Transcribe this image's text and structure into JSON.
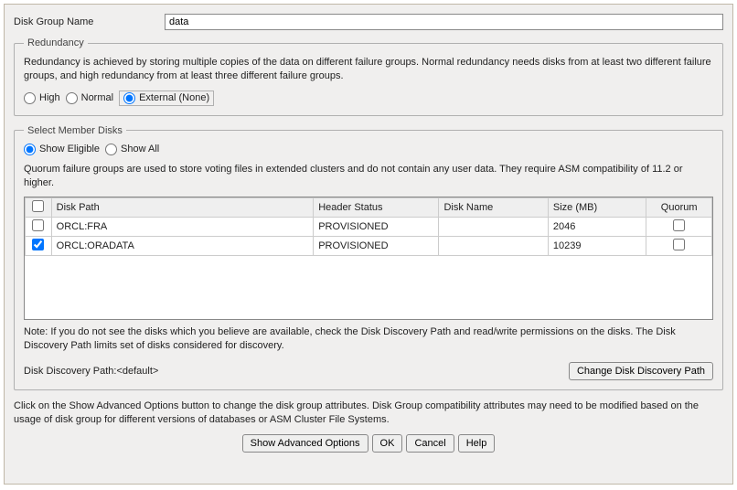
{
  "group_name_label": "Disk Group Name",
  "group_name_value": "data",
  "redundancy": {
    "legend": "Redundancy",
    "desc": "Redundancy is achieved by storing multiple copies of the data on different failure groups. Normal redundancy needs disks from at least two different failure groups, and high redundancy from at least three different failure groups.",
    "high": "High",
    "normal": "Normal",
    "external": "External (None)"
  },
  "member_disks": {
    "legend": "Select Member Disks",
    "show_eligible": "Show Eligible",
    "show_all": "Show All",
    "quorum_desc": "Quorum failure groups are used to store voting files in extended clusters and do not contain any user data. They require ASM compatibility of 11.2 or higher.",
    "columns": {
      "disk_path": "Disk Path",
      "header_status": "Header Status",
      "disk_name": "Disk Name",
      "size_mb": "Size (MB)",
      "quorum": "Quorum"
    },
    "rows": [
      {
        "checked": false,
        "path": "ORCL:FRA",
        "header": "PROVISIONED",
        "name": "",
        "size": "2046",
        "quorum": false
      },
      {
        "checked": true,
        "path": "ORCL:ORADATA",
        "header": "PROVISIONED",
        "name": "",
        "size": "10239",
        "quorum": false
      }
    ],
    "note": "Note: If you do not see the disks which you believe are available, check the Disk Discovery Path and read/write permissions on the disks. The Disk Discovery Path limits set of disks considered for discovery.",
    "discovery_path": "Disk Discovery Path:<default>",
    "change_path_button": "Change Disk Discovery Path"
  },
  "footer": {
    "text": "Click on the Show Advanced Options button to change the disk group attributes. Disk Group compatibility attributes may need to be modified based on the usage of disk group for different versions of databases or ASM Cluster File Systems.",
    "show_advanced": "Show Advanced Options",
    "ok": "OK",
    "cancel": "Cancel",
    "help": "Help"
  }
}
